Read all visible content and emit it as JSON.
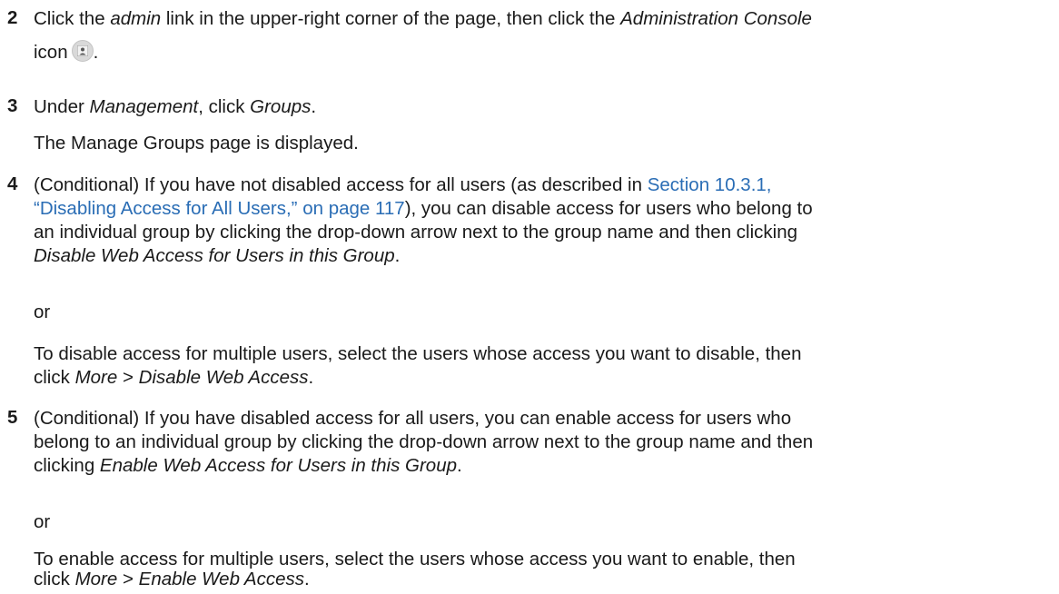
{
  "steps": [
    {
      "number": "2",
      "line1_a": "Click the ",
      "line1_b": "admin",
      "line1_c": " link in the upper-right corner of the page, then click the ",
      "line1_d": "Administration Console",
      "line2_a": "icon",
      "line2_b": "."
    },
    {
      "number": "3",
      "line1_a": "Under ",
      "line1_b": "Management",
      "line1_c": ", click ",
      "line1_d": "Groups",
      "line1_e": ".",
      "para": "The Manage Groups page is displayed."
    },
    {
      "number": "4",
      "line1_a": "(Conditional) If you have not disabled access for all users (as described in ",
      "link1": "Section 10.3.1,",
      "link2": "“Disabling Access for All Users,” on page 117",
      "line2_b": "), you can disable access for users who belong to",
      "line3": "an individual group by clicking the drop-down arrow next to the group name and then clicking",
      "line4_a": "Disable Web Access for Users in this Group",
      "line4_b": ".",
      "or": "or",
      "alt_line1": "To disable access for multiple users, select the users whose access you want to disable, then",
      "alt_line2_a": "click ",
      "alt_line2_b": "More",
      "alt_line2_c": " > ",
      "alt_line2_d": "Disable Web Access",
      "alt_line2_e": "."
    },
    {
      "number": "5",
      "line1": "(Conditional) If you have disabled access for all users, you can enable access for users who",
      "line2": "belong to an individual group by clicking the drop-down arrow next to the group name and then",
      "line3_a": "clicking ",
      "line3_b": "Enable Web Access for Users in this Group",
      "line3_c": ".",
      "or": "or",
      "alt_line1": "To enable access for multiple users, select the users whose access you want to enable, then",
      "alt_line2_a": "click ",
      "alt_line2_b": "More",
      "alt_line2_c": " > ",
      "alt_line2_d": "Enable Web Access",
      "alt_line2_e": "."
    }
  ]
}
